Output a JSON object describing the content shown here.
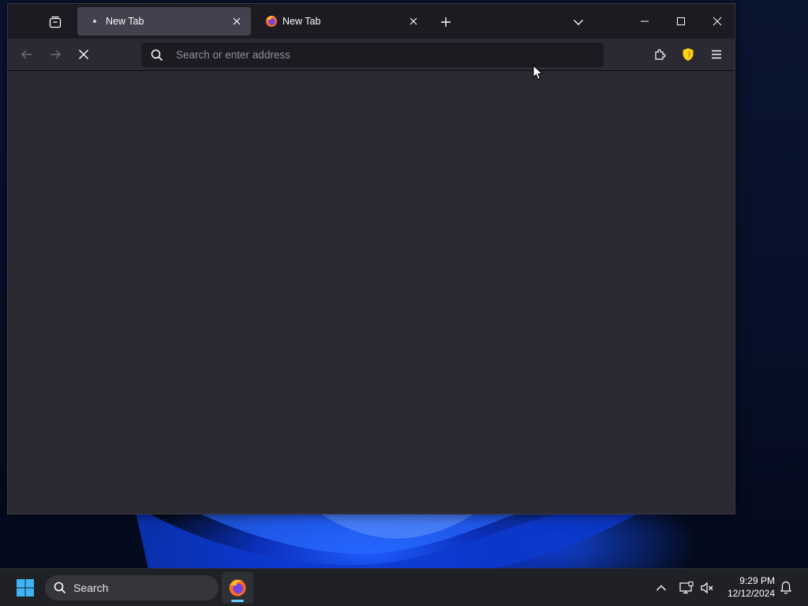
{
  "browser": {
    "tabs": [
      {
        "title": "New Tab",
        "state": "loading",
        "active": true
      },
      {
        "title": "New Tab",
        "state": "loaded",
        "active": false
      }
    ],
    "urlbar": {
      "placeholder": "Search or enter address",
      "value": ""
    }
  },
  "taskbar": {
    "search_label": "Search",
    "clock": {
      "time": "9:29 PM",
      "date": "12/12/2024"
    }
  },
  "colors": {
    "tab_bar": "#1c1b22",
    "toolbar": "#2b2a33",
    "active_tab": "#42414d",
    "shield": "#ffd50a",
    "taskbar": "#1f2126",
    "running_indicator": "#60cdff"
  }
}
